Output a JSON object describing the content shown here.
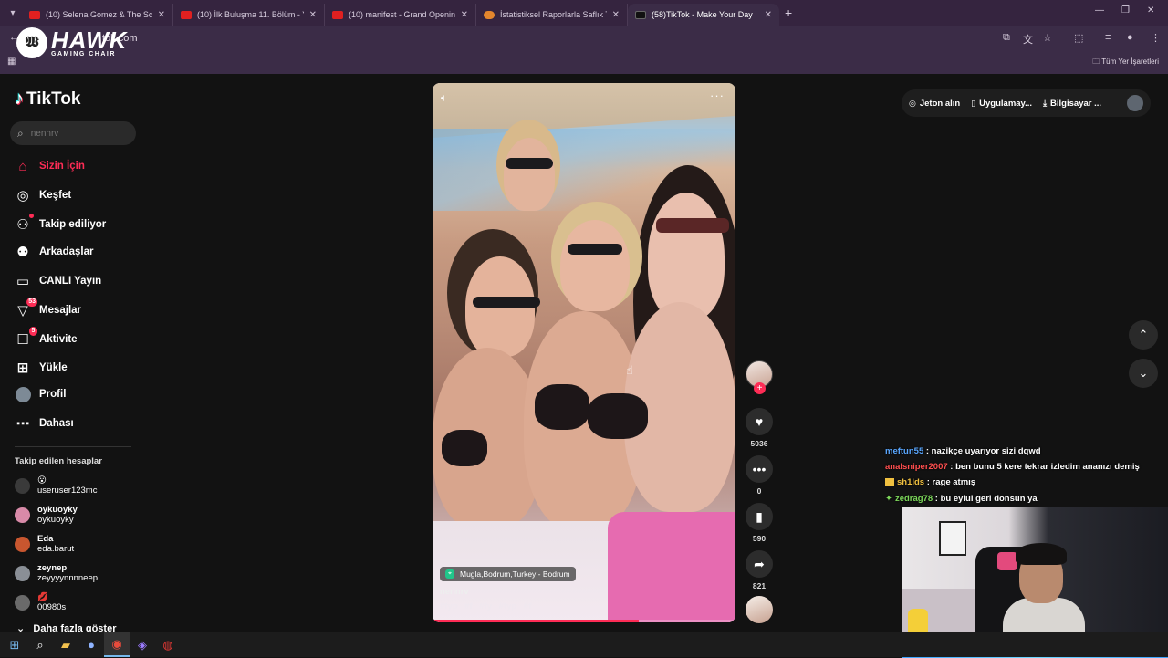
{
  "browser": {
    "tabs": [
      {
        "title": "(10) Selena Gomez & The Scene",
        "icon": "youtube-icon"
      },
      {
        "title": "(10) İlk Buluşma 11. Bölüm - Yo",
        "icon": "youtube-icon"
      },
      {
        "title": "(10) manifest - Grand Opening",
        "icon": "youtube-icon"
      },
      {
        "title": "İstatistiksel Raporlarla Saflık Te",
        "icon": "tab-icon"
      },
      {
        "title": "(58)TikTok - Make Your Day",
        "icon": "tiktok-icon",
        "active": true
      }
    ],
    "url": "tok.com",
    "bookmarks_label": "Tüm Yer İşaretleri"
  },
  "overlay_logo": {
    "brand": "HAWK",
    "tagline": "GAMING CHAIR"
  },
  "tiktok": {
    "logo": "TikTok",
    "search_placeholder": "nennrv",
    "nav": [
      {
        "label": "Sizin İçin",
        "icon": "home-icon",
        "active": true
      },
      {
        "label": "Keşfet",
        "icon": "compass-icon"
      },
      {
        "label": "Takip ediliyor",
        "icon": "following-icon",
        "dot": true
      },
      {
        "label": "Arkadaşlar",
        "icon": "friends-icon"
      },
      {
        "label": "CANLI Yayın",
        "icon": "live-icon"
      },
      {
        "label": "Mesajlar",
        "icon": "messages-icon",
        "badge": "53"
      },
      {
        "label": "Aktivite",
        "icon": "activity-icon",
        "badge": "5"
      },
      {
        "label": "Yükle",
        "icon": "upload-icon"
      },
      {
        "label": "Profil",
        "icon": "profile-icon"
      },
      {
        "label": "Dahası",
        "icon": "more-icon"
      }
    ],
    "following_title": "Takip edilen hesaplar",
    "accounts": [
      {
        "name": "😮",
        "handle": "useruser123mc",
        "color": "#3a3a3a"
      },
      {
        "name": "oykuoyky",
        "handle": "oykuoyky",
        "color": "#d88aa8"
      },
      {
        "name": "Eda",
        "handle": "eda.barut",
        "color": "#c8562f"
      },
      {
        "name": "zeynep",
        "handle": "zeyyyynnnneep",
        "color": "#8a8f96"
      },
      {
        "name": "💋",
        "handle": "00980s",
        "color": "#6a6a6a"
      }
    ],
    "show_more": "Daha fazla göster",
    "video": {
      "location": "Mugla,Bodrum,Turkey - Bodrum",
      "author": "nennrv",
      "hashtags": "#fyp #f #fy #fyp #f",
      "progress": 0.68
    },
    "actions": {
      "likes": "5036",
      "comments": "0",
      "saves": "590",
      "shares": "821"
    },
    "top_buttons": {
      "coins": "Jeton alın",
      "app": "Uygulamay...",
      "desktop": "Bilgisayar ..."
    }
  },
  "chat": [
    {
      "user": "meftun55",
      "color": "#5aa7ff",
      "msg": " : nazikçe uyarıyor sizi dqwd"
    },
    {
      "user": "analsniper2007",
      "color": "#ff4f4f",
      "msg": " : ben bunu 5 kere tekrar izledim ananızı demiş"
    },
    {
      "user": "sh1lds",
      "color": "#f0c040",
      "msg": " : rage atmış"
    },
    {
      "user": "zedrag78",
      "color": "#7dd85b",
      "msg": " : bu eylul geri donsun ya"
    }
  ]
}
